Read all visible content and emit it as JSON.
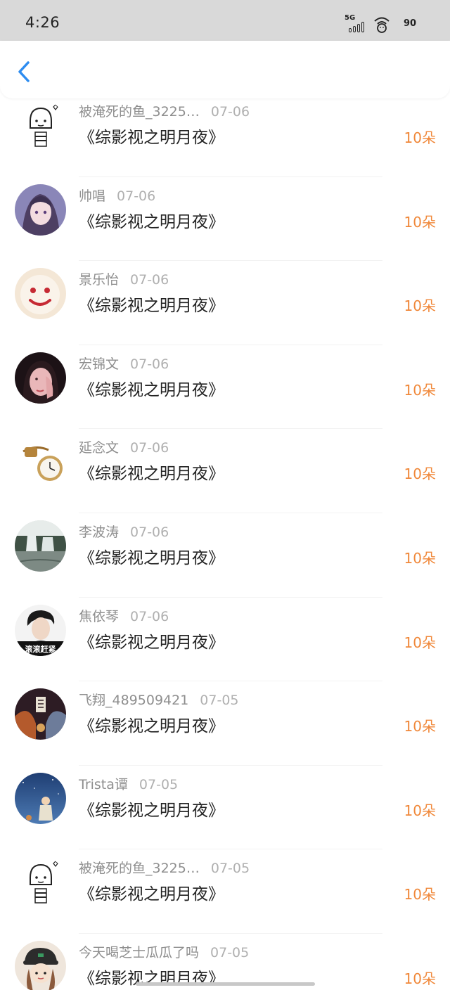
{
  "status_bar": {
    "time": "4:26",
    "network": "5G",
    "battery": "90"
  },
  "nav": {
    "back_icon": "chevron-left-icon",
    "accent_color": "#2d8cf0"
  },
  "colors": {
    "amount": "#f0883a",
    "name": "#8e8e8e",
    "title": "#222222"
  },
  "items": [
    {
      "name": "被淹死的鱼_3225…",
      "date": "07-06",
      "title": "《综影视之明月夜》",
      "amount": "10朵",
      "avatar": "sketch-girl"
    },
    {
      "name": "帅唱",
      "date": "07-06",
      "title": "《综影视之明月夜》",
      "amount": "10朵",
      "avatar": "anime-girl"
    },
    {
      "name": "景乐怡",
      "date": "07-06",
      "title": "《综影视之明月夜》",
      "amount": "10朵",
      "avatar": "smiley-cake"
    },
    {
      "name": "宏锦文",
      "date": "07-06",
      "title": "《综影视之明月夜》",
      "amount": "10朵",
      "avatar": "girl-photo"
    },
    {
      "name": "延念文",
      "date": "07-06",
      "title": "《综影视之明月夜》",
      "amount": "10朵",
      "avatar": "pocket-watch"
    },
    {
      "name": "李波涛",
      "date": "07-06",
      "title": "《综影视之明月夜》",
      "amount": "10朵",
      "avatar": "waterfall"
    },
    {
      "name": "焦依琴",
      "date": "07-06",
      "title": "《综影视之明月夜》",
      "amount": "10朵",
      "avatar": "boy-portrait"
    },
    {
      "name": "飞翔_489509421",
      "date": "07-05",
      "title": "《综影视之明月夜》",
      "amount": "10朵",
      "avatar": "poster-art"
    },
    {
      "name": "Trista谭",
      "date": "07-05",
      "title": "《综影视之明月夜》",
      "amount": "10朵",
      "avatar": "night-sky"
    },
    {
      "name": "被淹死的鱼_3225…",
      "date": "07-05",
      "title": "《综影视之明月夜》",
      "amount": "10朵",
      "avatar": "sketch-girl"
    },
    {
      "name": "今天喝芝士瓜瓜了吗",
      "date": "07-05",
      "title": "《综影视之明月夜》",
      "amount": "10朵",
      "avatar": "cartoon-hat"
    }
  ],
  "avatar_text": {
    "boy-portrait": "滚滚赶紧"
  }
}
